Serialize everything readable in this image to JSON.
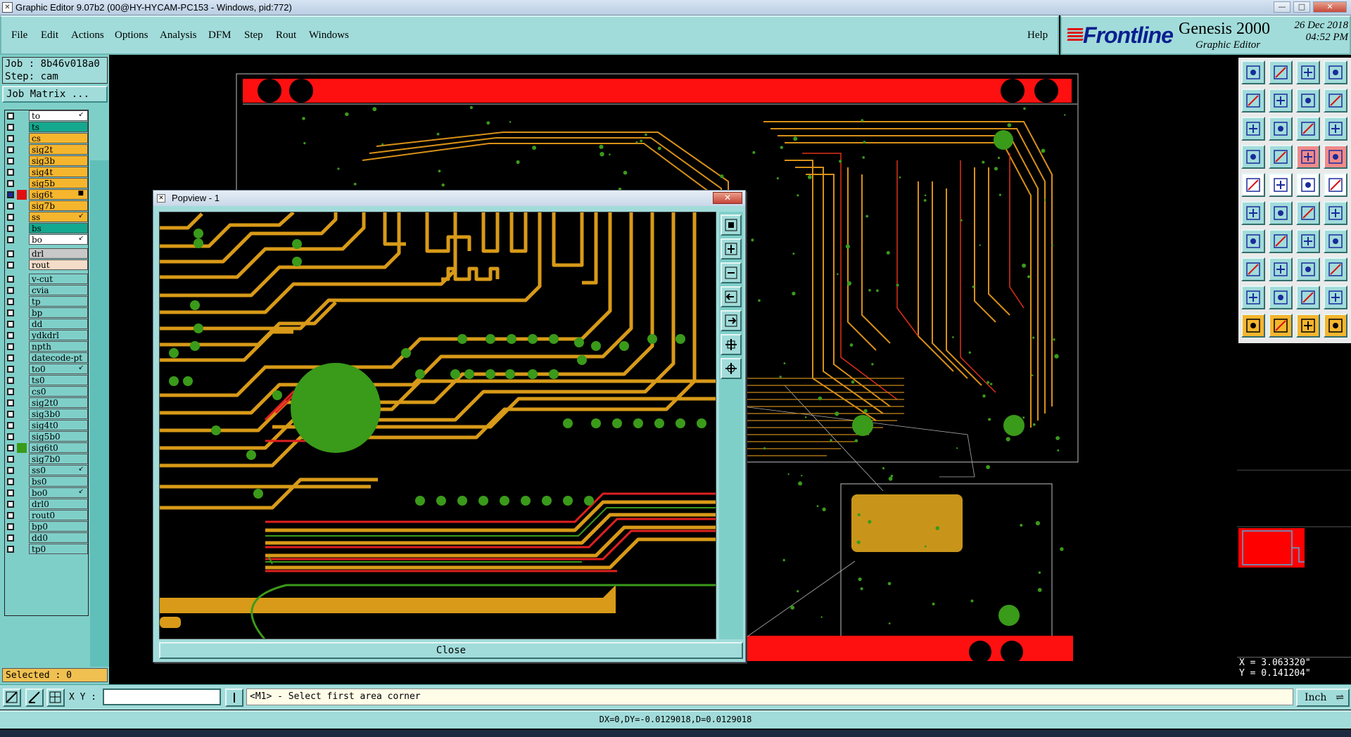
{
  "window": {
    "title": "Graphic Editor 9.07b2 (00@HY-HYCAM-PC153 - Windows, pid:772)",
    "icon": "app-icon",
    "controls": [
      "minimize",
      "maximize",
      "close"
    ]
  },
  "menu": {
    "items": [
      {
        "label": "File",
        "accel": "F"
      },
      {
        "label": "Edit",
        "accel": "E"
      },
      {
        "label": "Actions",
        "accel": "A"
      },
      {
        "label": "Options",
        "accel": "O"
      },
      {
        "label": "Analysis",
        "accel": "n"
      },
      {
        "label": "DFM",
        "accel": "D"
      },
      {
        "label": "Step",
        "accel": "S"
      },
      {
        "label": "Rout",
        "accel": "R"
      },
      {
        "label": "Windows",
        "accel": "W"
      }
    ],
    "help": "Help"
  },
  "brand": {
    "logo": "Frontline",
    "product": "Genesis 2000",
    "subtitle": "Graphic Editor",
    "date": "26 Dec 2018",
    "time": "04:52 PM"
  },
  "job": {
    "job_line": "Job : 8b46v018a0",
    "step_line": "Step: cam",
    "matrix_button": "Job Matrix ..."
  },
  "layers": {
    "group1": [
      {
        "name": "to",
        "color": "#ffffff",
        "checked": false,
        "mark": "↙"
      },
      {
        "name": "ts",
        "color": "#14a88e",
        "checked": false,
        "mark": ""
      },
      {
        "name": "cs",
        "color": "#f5b62e",
        "checked": false,
        "mark": ""
      },
      {
        "name": "sig2t",
        "color": "#f5b62e",
        "checked": false,
        "mark": ""
      },
      {
        "name": "sig3b",
        "color": "#f5b62e",
        "checked": false,
        "mark": ""
      },
      {
        "name": "sig4t",
        "color": "#f5b62e",
        "checked": false,
        "mark": ""
      },
      {
        "name": "sig5b",
        "color": "#f5b62e",
        "checked": false,
        "mark": ""
      },
      {
        "name": "sig6t",
        "color": "#f5b62e",
        "checked": true,
        "swatch": "#e01010",
        "mark": "■"
      },
      {
        "name": "sig7b",
        "color": "#f5b62e",
        "checked": false,
        "mark": ""
      },
      {
        "name": "ss",
        "color": "#f5b62e",
        "checked": false,
        "mark": "↙"
      },
      {
        "name": "bs",
        "color": "#14a88e",
        "checked": false,
        "mark": ""
      },
      {
        "name": "bo",
        "color": "#ffffff",
        "checked": false,
        "mark": "↙"
      }
    ],
    "group2": [
      {
        "name": "drl",
        "color": "#c8c8c8",
        "checked": false,
        "mark": ""
      },
      {
        "name": "rout",
        "color": "#f3dcc8",
        "checked": false,
        "mark": ""
      }
    ],
    "group3": [
      {
        "name": "v-cut",
        "color": "#7fcfc9",
        "checked": false,
        "mark": ""
      },
      {
        "name": "cvia",
        "color": "#7fcfc9",
        "checked": false,
        "mark": ""
      },
      {
        "name": "tp",
        "color": "#7fcfc9",
        "checked": false,
        "mark": ""
      },
      {
        "name": "bp",
        "color": "#7fcfc9",
        "checked": false,
        "mark": ""
      },
      {
        "name": "dd",
        "color": "#7fcfc9",
        "checked": false,
        "mark": ""
      },
      {
        "name": "ydkdrl",
        "color": "#7fcfc9",
        "checked": false,
        "mark": ""
      },
      {
        "name": "npth",
        "color": "#7fcfc9",
        "checked": false,
        "mark": ""
      },
      {
        "name": "datecode-pt",
        "color": "#7fcfc9",
        "checked": false,
        "mark": ""
      },
      {
        "name": "to0",
        "color": "#7fcfc9",
        "checked": false,
        "mark": "↙"
      },
      {
        "name": "ts0",
        "color": "#7fcfc9",
        "checked": false,
        "mark": ""
      },
      {
        "name": "cs0",
        "color": "#7fcfc9",
        "checked": false,
        "mark": ""
      },
      {
        "name": "sig2t0",
        "color": "#7fcfc9",
        "checked": false,
        "mark": ""
      },
      {
        "name": "sig3b0",
        "color": "#7fcfc9",
        "checked": false,
        "mark": ""
      },
      {
        "name": "sig4t0",
        "color": "#7fcfc9",
        "checked": false,
        "mark": ""
      },
      {
        "name": "sig5b0",
        "color": "#7fcfc9",
        "checked": false,
        "mark": ""
      },
      {
        "name": "sig6t0",
        "color": "#7fcfc9",
        "checked": false,
        "swatch": "#3a9a1a",
        "mark": ""
      },
      {
        "name": "sig7b0",
        "color": "#7fcfc9",
        "checked": false,
        "mark": ""
      },
      {
        "name": "ss0",
        "color": "#7fcfc9",
        "checked": false,
        "mark": "↙"
      },
      {
        "name": "bs0",
        "color": "#7fcfc9",
        "checked": false,
        "mark": ""
      },
      {
        "name": "bo0",
        "color": "#7fcfc9",
        "checked": false,
        "mark": "↙"
      },
      {
        "name": "drl0",
        "color": "#7fcfc9",
        "checked": false,
        "mark": ""
      },
      {
        "name": "rout0",
        "color": "#7fcfc9",
        "checked": false,
        "mark": ""
      },
      {
        "name": "bp0",
        "color": "#7fcfc9",
        "checked": false,
        "mark": ""
      },
      {
        "name": "dd0",
        "color": "#7fcfc9",
        "checked": false,
        "mark": ""
      },
      {
        "name": "tp0",
        "color": "#7fcfc9",
        "checked": false,
        "mark": ""
      }
    ]
  },
  "selected": "Selected : 0",
  "popview": {
    "title": "Popview - 1",
    "close_button": "Close",
    "tools": [
      "zoom-fit-icon",
      "zoom-in-icon",
      "zoom-out-icon",
      "pan-left-icon",
      "pan-right-icon",
      "zoom-home-icon",
      "zoom-window-icon"
    ]
  },
  "coords": {
    "x": "X = 3.063320\"",
    "y": "Y = 0.141204\""
  },
  "bottom": {
    "xy_label": "X Y :",
    "xy_value": "",
    "prompt": "<M1> - Select first area corner",
    "units": "Inch",
    "status": "DX=0,DY=-0.0129018,D=0.0129018"
  },
  "colors": {
    "panel": "#a1dcda",
    "trace_orange": "#e0a020",
    "trace_red": "#e02020",
    "pad_green": "#3a9a1a",
    "board_red": "#ff0000"
  }
}
